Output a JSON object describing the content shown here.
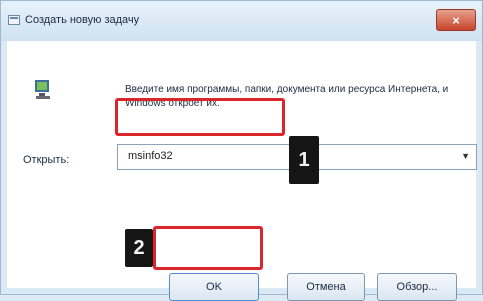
{
  "window": {
    "title": "Создать новую задачу",
    "close_label": "×"
  },
  "content": {
    "description": "Введите имя программы, папки, документа или ресурса Интернета, и Windows откроет их.",
    "open_label": "Открыть:",
    "input_value": "msinfo32"
  },
  "annotations": {
    "badge1": "1",
    "badge2": "2"
  },
  "buttons": {
    "ok_label": "OK",
    "cancel_label": "Отмена",
    "browse_label": "Обзор..."
  },
  "icons": {
    "window_icon": "task-window-icon",
    "run_icon": "run-program-icon",
    "dropdown_icon": "chevron-down-icon"
  }
}
